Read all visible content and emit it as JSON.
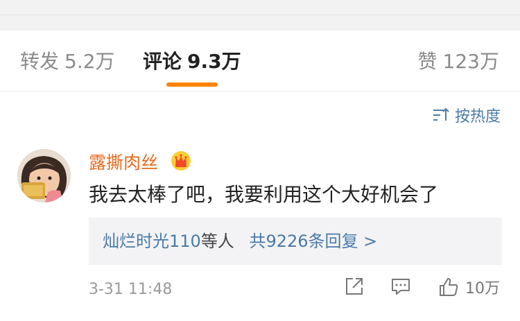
{
  "tabs": {
    "repost": {
      "label": "转发",
      "count": "5.2万"
    },
    "comments": {
      "label": "评论",
      "count": "9.3万"
    },
    "likes": {
      "label": "赞",
      "count": "123万"
    }
  },
  "sort": {
    "label": "按热度",
    "icon": "sort-icon"
  },
  "comment": {
    "username": "露撕肉丝",
    "badge_icon": "crown-badge-icon",
    "text": "我去太棒了吧，我要利用这个大好机会了",
    "replies": {
      "names": "灿烂时光110",
      "suffix": "等人",
      "total": "共9226条回复 >"
    },
    "time": "3-31 11:48",
    "like_count": "10万"
  },
  "colors": {
    "accent": "#ff8200",
    "link": "#4a7aa8",
    "username": "#e86a1d"
  }
}
